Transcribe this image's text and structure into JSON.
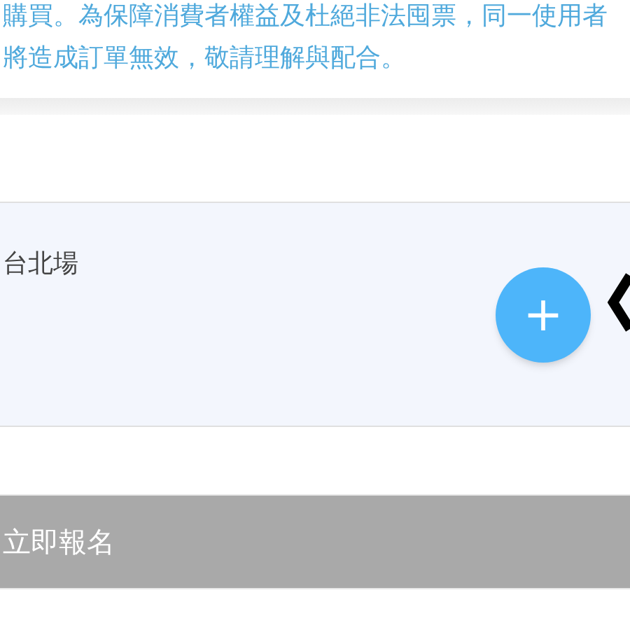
{
  "notice": {
    "lines": [
      "購買。為保障消費者權益及杜絕非法囤票，同一使用者",
      "將造成訂單無效，敬請理解與配合。"
    ]
  },
  "session": {
    "name": "台北場",
    "add_label": "+"
  },
  "register_button": {
    "label": "立即報名",
    "disabled": true
  }
}
